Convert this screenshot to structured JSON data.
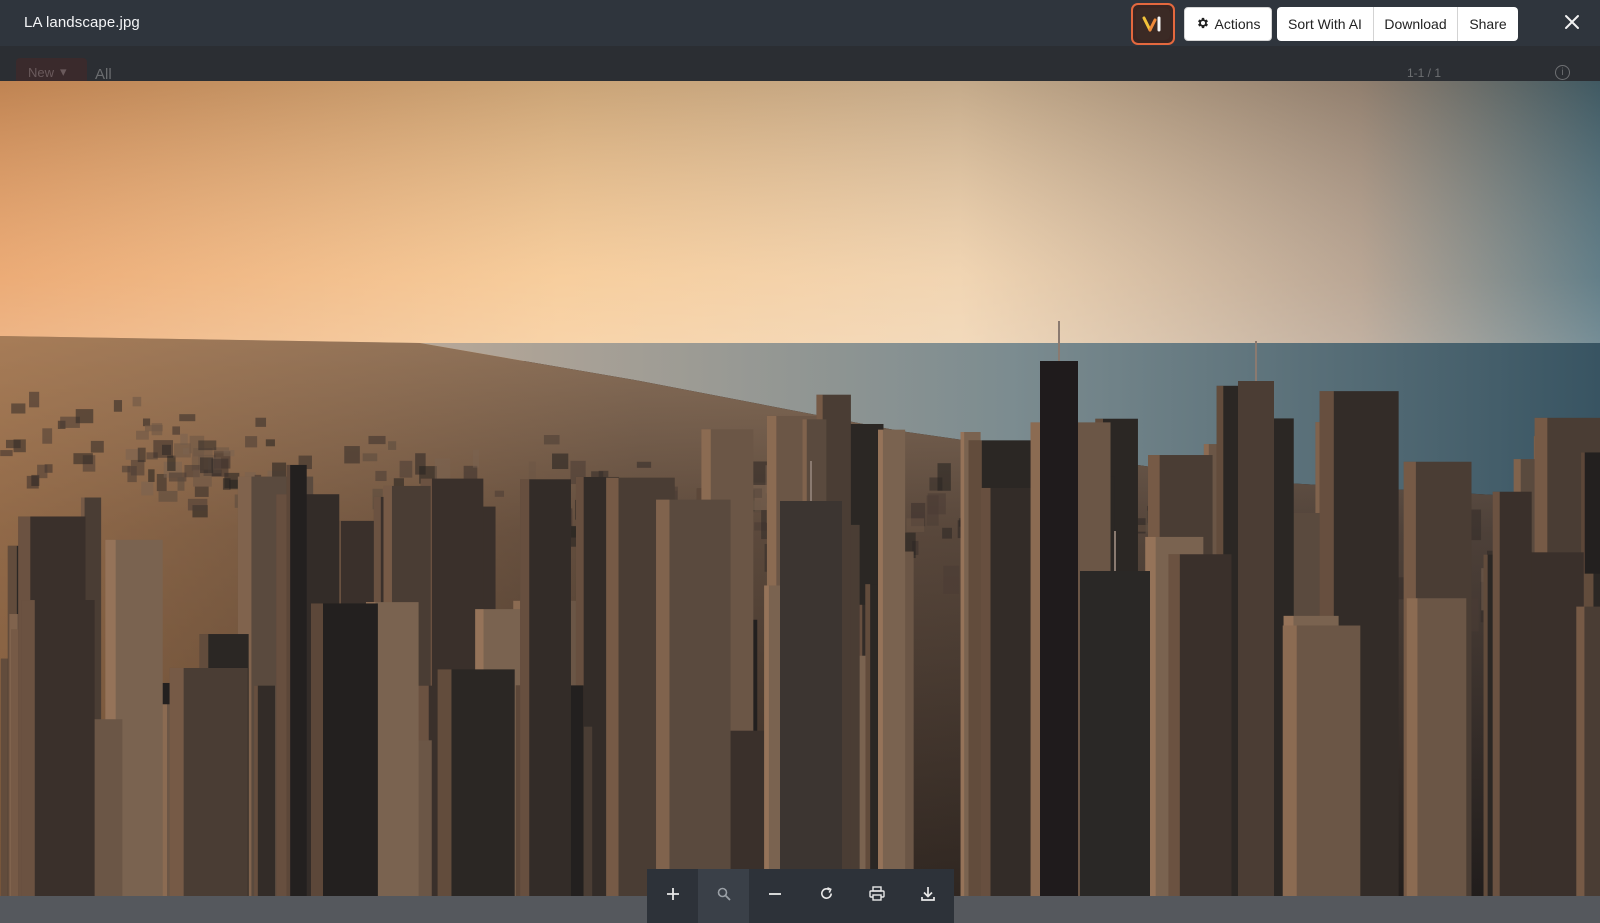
{
  "header": {
    "file_name": "LA landscape.jpg",
    "ai_badge_label": "AI",
    "actions_label": "Actions",
    "sort_label": "Sort With AI",
    "download_label": "Download",
    "share_label": "Share",
    "close_icon": "close-icon"
  },
  "background_app": {
    "new_label": "New",
    "filter_label": "All",
    "pagination": "1-1 / 1",
    "info_icon": "info-icon"
  },
  "image": {
    "alt": "Aerial city skyline at sunset",
    "colors": {
      "sky_warm": "#f4b678",
      "sky_cool": "#5d7a86",
      "water": "#3f5660",
      "city_dark": "#2a2523"
    }
  },
  "toolbar": {
    "tools": [
      {
        "name": "zoom-in",
        "icon": "plus-icon"
      },
      {
        "name": "zoom-reset",
        "icon": "magnifier-icon"
      },
      {
        "name": "zoom-out",
        "icon": "minus-icon"
      },
      {
        "name": "rotate",
        "icon": "rotate-icon"
      },
      {
        "name": "print",
        "icon": "printer-icon"
      },
      {
        "name": "download",
        "icon": "download-icon"
      }
    ]
  },
  "colors": {
    "topbar": "#2f353d",
    "accent": "#e4683e"
  }
}
